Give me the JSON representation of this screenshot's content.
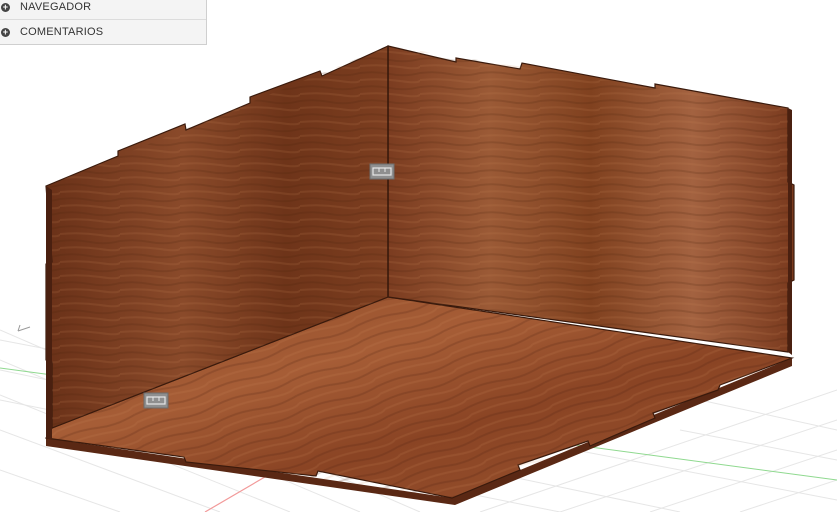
{
  "browser": {
    "items": [
      {
        "label": "NAVEGADOR",
        "icon": "expand-plus-icon"
      },
      {
        "label": "COMENTARIOS",
        "icon": "expand-plus-icon"
      }
    ]
  },
  "scene": {
    "object": "wooden box with finger-joint panels",
    "material": "wood",
    "colors": {
      "wood_dark": "#5a2a16",
      "wood_mid": "#8a4a2a",
      "wood_light": "#b06a42",
      "edge": "#3a1a0c",
      "grid": "#e4e4e4",
      "axis_green": "#7fd27f",
      "axis_red": "#f08080"
    }
  }
}
